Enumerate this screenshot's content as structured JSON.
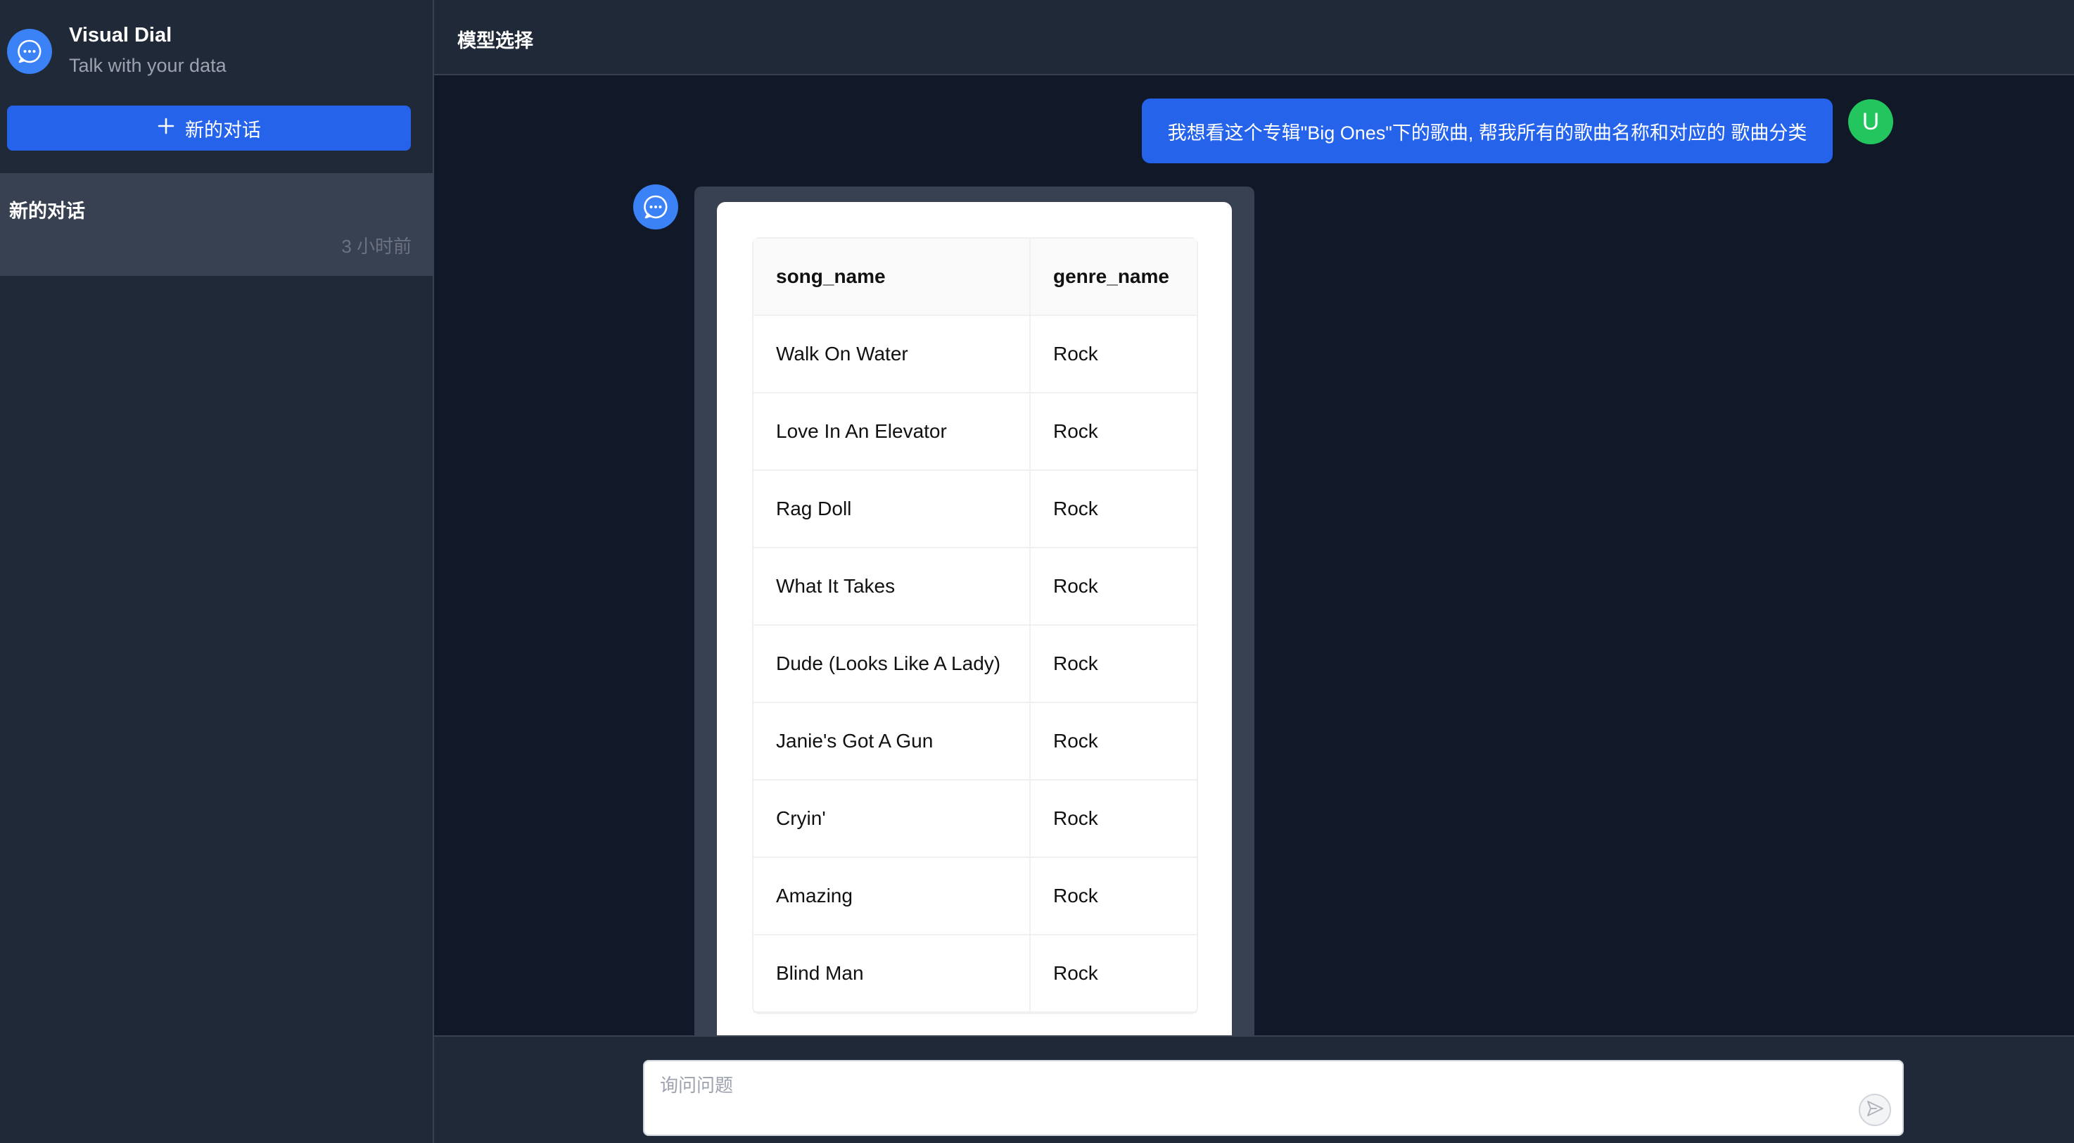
{
  "sidebar": {
    "brand_title": "Visual Dial",
    "brand_subtitle": "Talk with your data",
    "new_chat_label": "新的对话",
    "conversations": [
      {
        "title": "新的对话",
        "time": "3 小时前"
      }
    ]
  },
  "header": {
    "model_select_label": "模型选择"
  },
  "chat": {
    "user_message": "我想看这个专辑\"Big Ones\"下的歌曲, 帮我所有的歌曲名称和对应的 歌曲分类",
    "user_avatar_letter": "U",
    "result_table": {
      "columns": [
        "song_name",
        "genre_name"
      ],
      "rows": [
        [
          "Walk On Water",
          "Rock"
        ],
        [
          "Love In An Elevator",
          "Rock"
        ],
        [
          "Rag Doll",
          "Rock"
        ],
        [
          "What It Takes",
          "Rock"
        ],
        [
          "Dude (Looks Like A Lady)",
          "Rock"
        ],
        [
          "Janie's Got A Gun",
          "Rock"
        ],
        [
          "Cryin'",
          "Rock"
        ],
        [
          "Amazing",
          "Rock"
        ],
        [
          "Blind Man",
          "Rock"
        ]
      ]
    }
  },
  "composer": {
    "placeholder": "询问问题"
  },
  "colors": {
    "accent": "#2563eb",
    "bot_avatar": "#3b82f6",
    "user_avatar": "#22c55e"
  },
  "icons": {
    "brand": "chat-bubble-dots-icon",
    "new_chat": "plus-icon",
    "bot_avatar": "chat-bubble-dots-icon",
    "send": "send-icon"
  }
}
